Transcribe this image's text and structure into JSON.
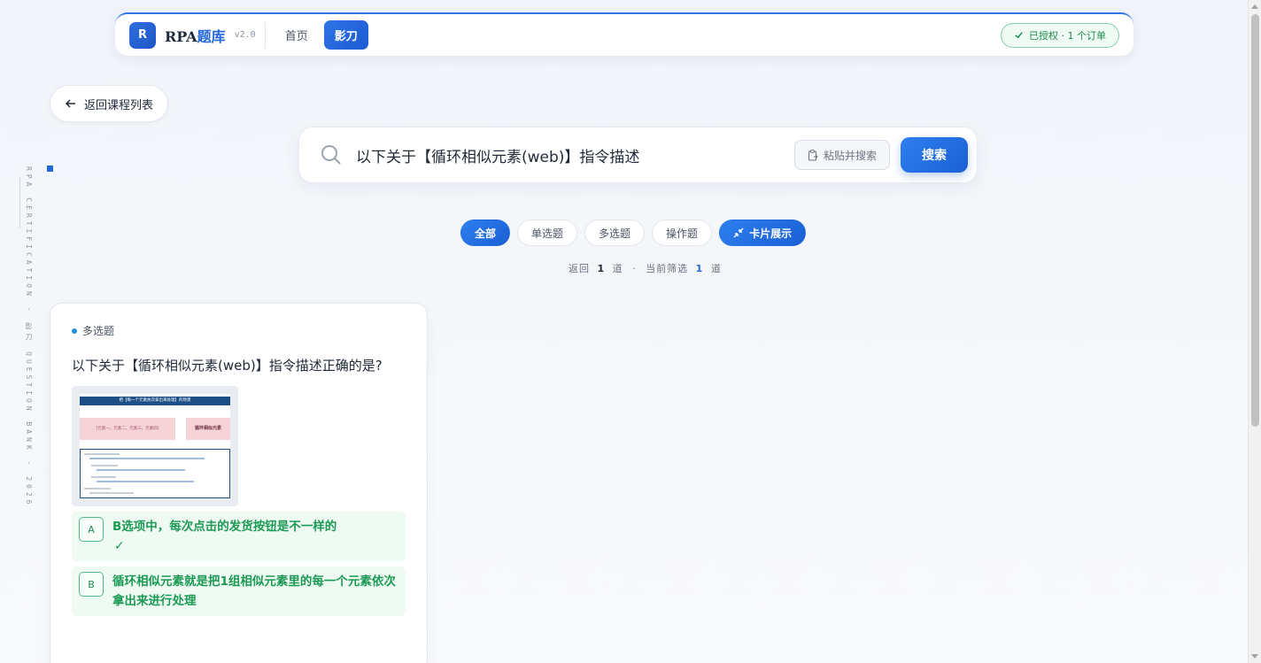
{
  "nav": {
    "logo_letter": "R",
    "brand_prefix": "RPA",
    "brand_suffix": "题库",
    "version": "v2.0",
    "links": [
      {
        "label": "首页",
        "active": false
      },
      {
        "label": "影刀",
        "active": true
      }
    ],
    "license_text": "已授权 · 1 个订单"
  },
  "back_button": {
    "label": "返回课程列表"
  },
  "side_text": "RPA CERTIFICATION · 影刀 QUESTION BANK · 2026",
  "search": {
    "value": "以下关于【循环相似元素(web)】指令描述",
    "paste_label": "粘贴并搜索",
    "button_label": "搜索"
  },
  "filters": [
    {
      "label": "全部",
      "active": true
    },
    {
      "label": "单选题",
      "active": false
    },
    {
      "label": "多选题",
      "active": false
    },
    {
      "label": "操作题",
      "active": false
    }
  ],
  "view_toggle": {
    "label": "卡片展示"
  },
  "result_count": {
    "prefix": "返回",
    "total": "1",
    "unit1": "道",
    "sep": "·",
    "middle": "当前筛选",
    "filtered": "1",
    "unit2": "道"
  },
  "question": {
    "type": "多选题",
    "title": "以下关于【循环相似元素(web)】指令描述正确的是?",
    "image": {
      "title": "把【每一个元素依次拿出来处理】的场景",
      "left_box": "[元素一，元素二，元素三，元素四]",
      "right_box": "循环相似元素"
    },
    "options": [
      {
        "letter": "A",
        "text": "B选项中，每次点击的发货按钮是不一样的",
        "correct_mark": "✓"
      },
      {
        "letter": "B",
        "text": "循环相似元素就是把1组相似元素里的每一个元素依次拿出来进行处理",
        "correct_mark": ""
      }
    ]
  },
  "colors": {
    "accent": "#2167d8",
    "success": "#1c9a55"
  }
}
